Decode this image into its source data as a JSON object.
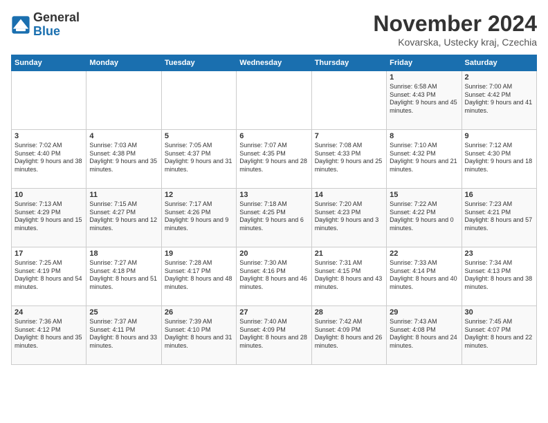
{
  "logo": {
    "general": "General",
    "blue": "Blue"
  },
  "title": "November 2024",
  "subtitle": "Kovarska, Ustecky kraj, Czechia",
  "days_of_week": [
    "Sunday",
    "Monday",
    "Tuesday",
    "Wednesday",
    "Thursday",
    "Friday",
    "Saturday"
  ],
  "weeks": [
    [
      {
        "day": "",
        "data": ""
      },
      {
        "day": "",
        "data": ""
      },
      {
        "day": "",
        "data": ""
      },
      {
        "day": "",
        "data": ""
      },
      {
        "day": "",
        "data": ""
      },
      {
        "day": "1",
        "data": "Sunrise: 6:58 AM\nSunset: 4:43 PM\nDaylight: 9 hours and 45 minutes."
      },
      {
        "day": "2",
        "data": "Sunrise: 7:00 AM\nSunset: 4:42 PM\nDaylight: 9 hours and 41 minutes."
      }
    ],
    [
      {
        "day": "3",
        "data": "Sunrise: 7:02 AM\nSunset: 4:40 PM\nDaylight: 9 hours and 38 minutes."
      },
      {
        "day": "4",
        "data": "Sunrise: 7:03 AM\nSunset: 4:38 PM\nDaylight: 9 hours and 35 minutes."
      },
      {
        "day": "5",
        "data": "Sunrise: 7:05 AM\nSunset: 4:37 PM\nDaylight: 9 hours and 31 minutes."
      },
      {
        "day": "6",
        "data": "Sunrise: 7:07 AM\nSunset: 4:35 PM\nDaylight: 9 hours and 28 minutes."
      },
      {
        "day": "7",
        "data": "Sunrise: 7:08 AM\nSunset: 4:33 PM\nDaylight: 9 hours and 25 minutes."
      },
      {
        "day": "8",
        "data": "Sunrise: 7:10 AM\nSunset: 4:32 PM\nDaylight: 9 hours and 21 minutes."
      },
      {
        "day": "9",
        "data": "Sunrise: 7:12 AM\nSunset: 4:30 PM\nDaylight: 9 hours and 18 minutes."
      }
    ],
    [
      {
        "day": "10",
        "data": "Sunrise: 7:13 AM\nSunset: 4:29 PM\nDaylight: 9 hours and 15 minutes."
      },
      {
        "day": "11",
        "data": "Sunrise: 7:15 AM\nSunset: 4:27 PM\nDaylight: 9 hours and 12 minutes."
      },
      {
        "day": "12",
        "data": "Sunrise: 7:17 AM\nSunset: 4:26 PM\nDaylight: 9 hours and 9 minutes."
      },
      {
        "day": "13",
        "data": "Sunrise: 7:18 AM\nSunset: 4:25 PM\nDaylight: 9 hours and 6 minutes."
      },
      {
        "day": "14",
        "data": "Sunrise: 7:20 AM\nSunset: 4:23 PM\nDaylight: 9 hours and 3 minutes."
      },
      {
        "day": "15",
        "data": "Sunrise: 7:22 AM\nSunset: 4:22 PM\nDaylight: 9 hours and 0 minutes."
      },
      {
        "day": "16",
        "data": "Sunrise: 7:23 AM\nSunset: 4:21 PM\nDaylight: 8 hours and 57 minutes."
      }
    ],
    [
      {
        "day": "17",
        "data": "Sunrise: 7:25 AM\nSunset: 4:19 PM\nDaylight: 8 hours and 54 minutes."
      },
      {
        "day": "18",
        "data": "Sunrise: 7:27 AM\nSunset: 4:18 PM\nDaylight: 8 hours and 51 minutes."
      },
      {
        "day": "19",
        "data": "Sunrise: 7:28 AM\nSunset: 4:17 PM\nDaylight: 8 hours and 48 minutes."
      },
      {
        "day": "20",
        "data": "Sunrise: 7:30 AM\nSunset: 4:16 PM\nDaylight: 8 hours and 46 minutes."
      },
      {
        "day": "21",
        "data": "Sunrise: 7:31 AM\nSunset: 4:15 PM\nDaylight: 8 hours and 43 minutes."
      },
      {
        "day": "22",
        "data": "Sunrise: 7:33 AM\nSunset: 4:14 PM\nDaylight: 8 hours and 40 minutes."
      },
      {
        "day": "23",
        "data": "Sunrise: 7:34 AM\nSunset: 4:13 PM\nDaylight: 8 hours and 38 minutes."
      }
    ],
    [
      {
        "day": "24",
        "data": "Sunrise: 7:36 AM\nSunset: 4:12 PM\nDaylight: 8 hours and 35 minutes."
      },
      {
        "day": "25",
        "data": "Sunrise: 7:37 AM\nSunset: 4:11 PM\nDaylight: 8 hours and 33 minutes."
      },
      {
        "day": "26",
        "data": "Sunrise: 7:39 AM\nSunset: 4:10 PM\nDaylight: 8 hours and 31 minutes."
      },
      {
        "day": "27",
        "data": "Sunrise: 7:40 AM\nSunset: 4:09 PM\nDaylight: 8 hours and 28 minutes."
      },
      {
        "day": "28",
        "data": "Sunrise: 7:42 AM\nSunset: 4:09 PM\nDaylight: 8 hours and 26 minutes."
      },
      {
        "day": "29",
        "data": "Sunrise: 7:43 AM\nSunset: 4:08 PM\nDaylight: 8 hours and 24 minutes."
      },
      {
        "day": "30",
        "data": "Sunrise: 7:45 AM\nSunset: 4:07 PM\nDaylight: 8 hours and 22 minutes."
      }
    ]
  ]
}
